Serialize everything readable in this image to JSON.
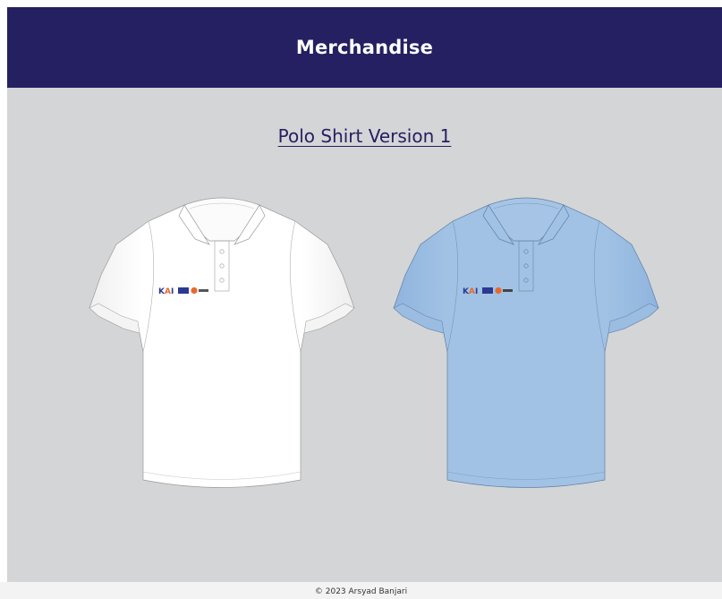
{
  "header": {
    "title": "Merchandise"
  },
  "product": {
    "title": "Polo Shirt Version 1",
    "variants": [
      {
        "name": "white-polo",
        "color": "#ffffff",
        "logo": "KAI"
      },
      {
        "name": "blue-polo",
        "color": "#a1c2e4",
        "logo": "KAI"
      }
    ]
  },
  "footer": {
    "copyright": "© 2023 Arsyad Banjari"
  },
  "colors": {
    "header_bg": "#252061",
    "main_bg": "#d4d5d7",
    "link": "#252061"
  }
}
